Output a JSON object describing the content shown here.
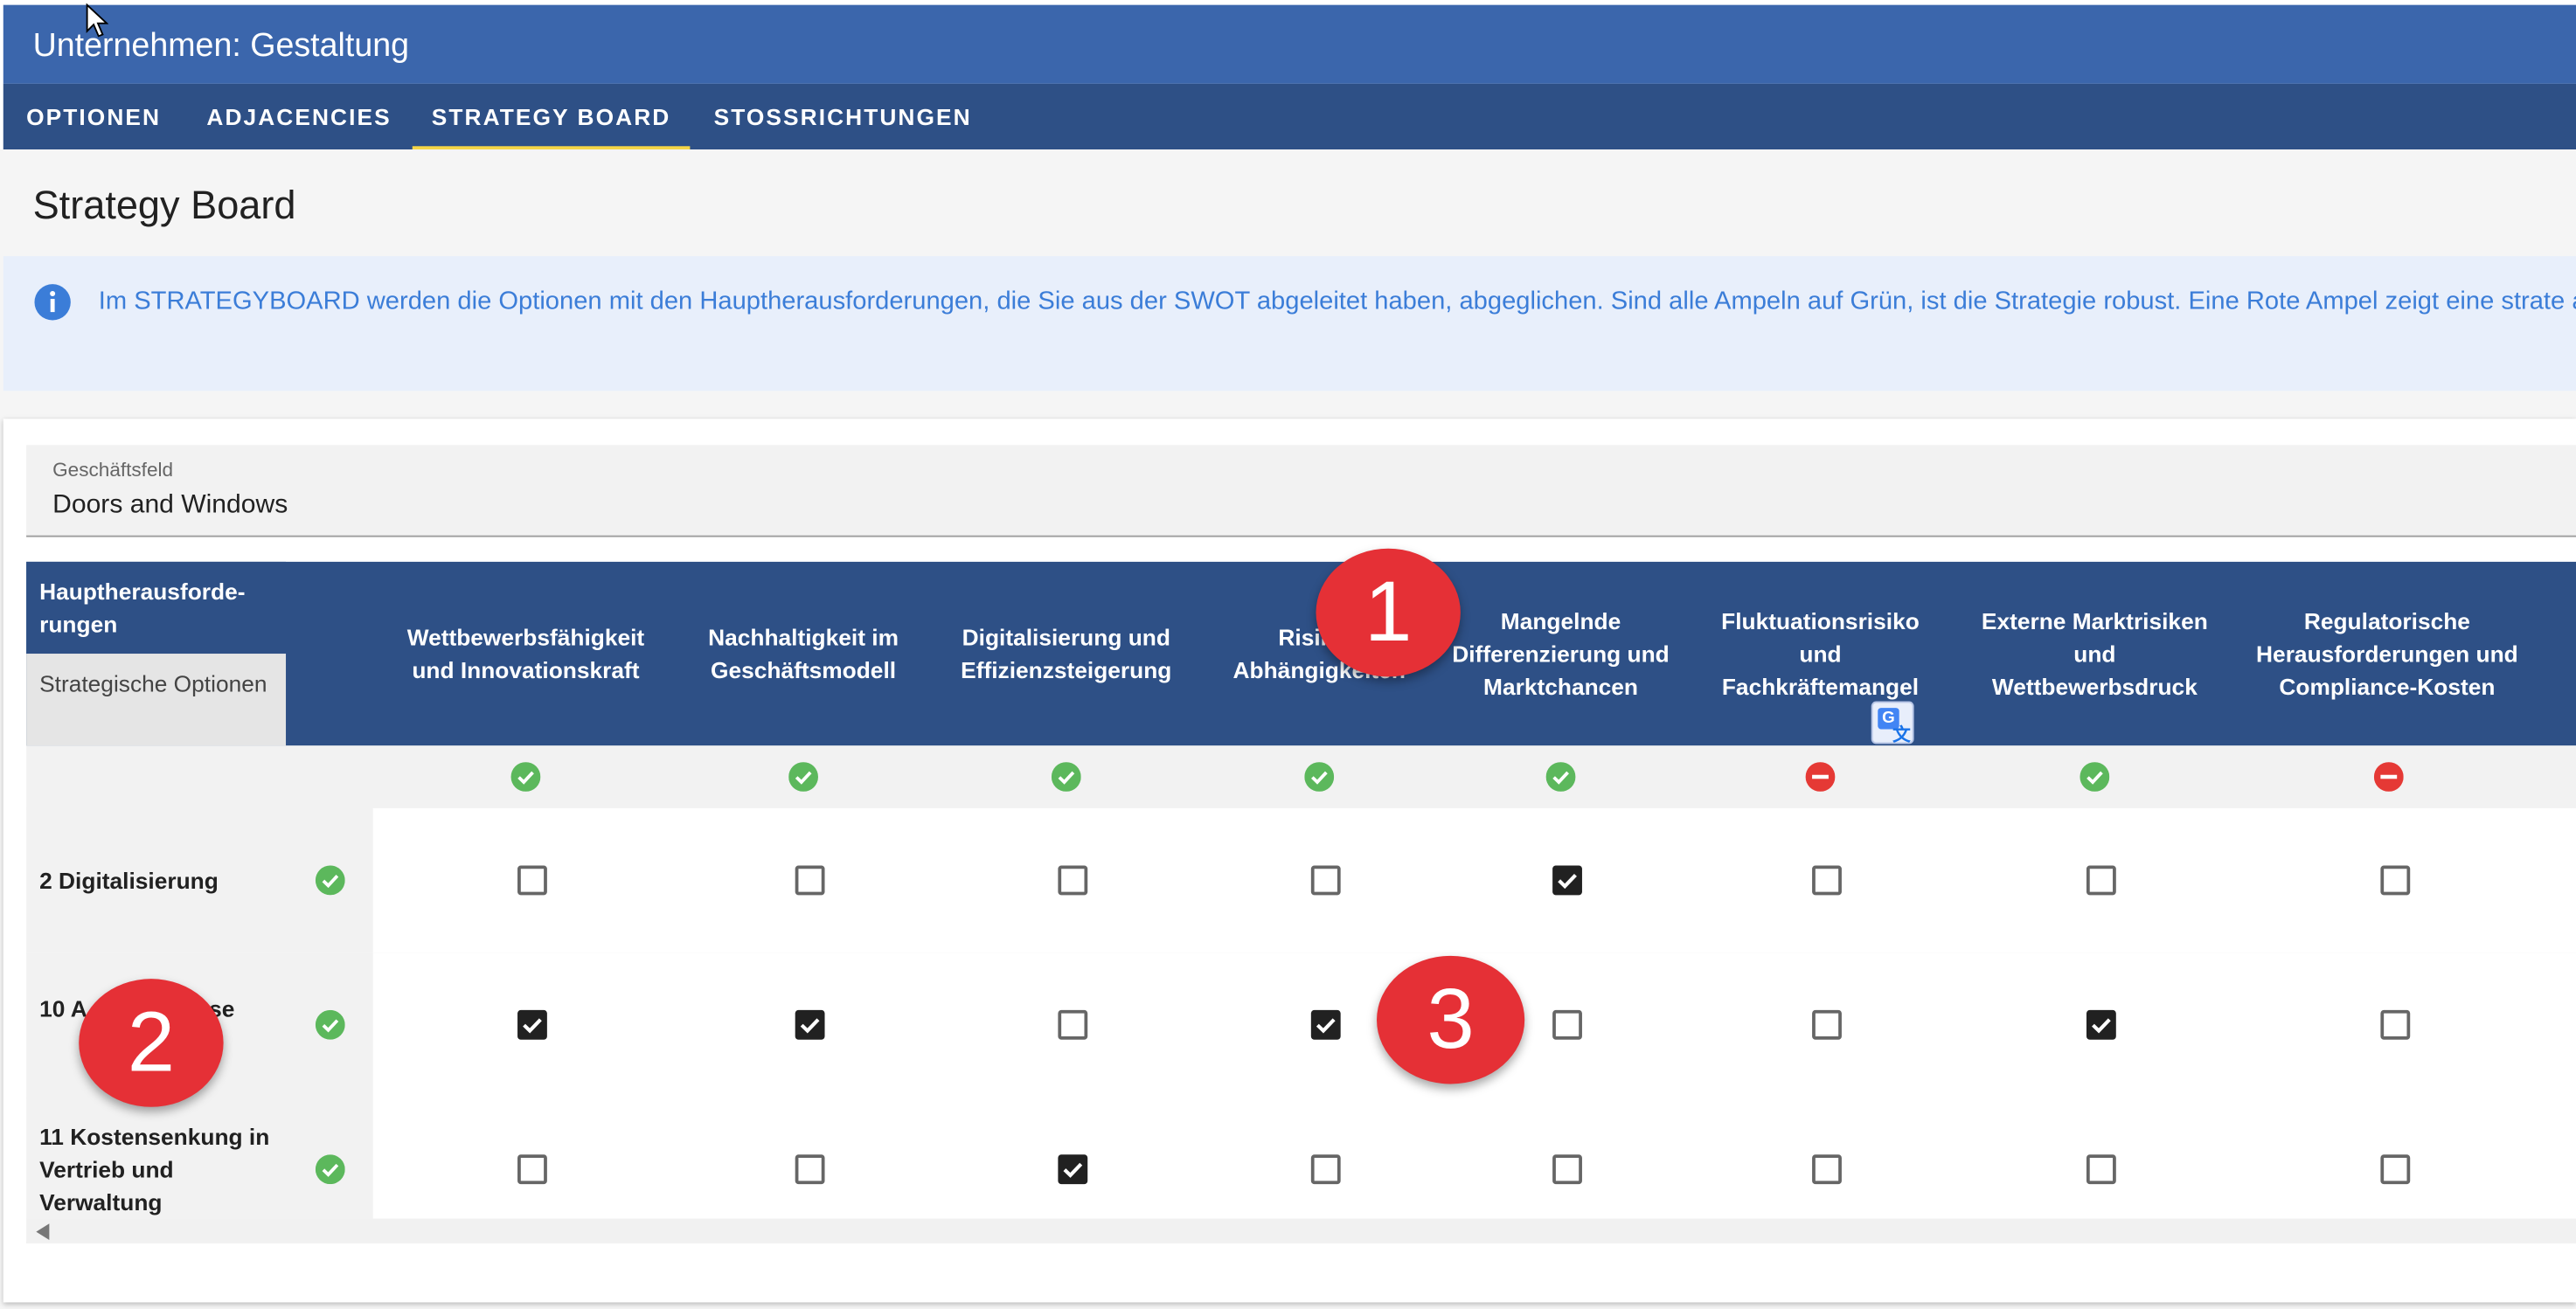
{
  "app": {
    "title": "Unternehmen: Gestaltung"
  },
  "tabs": [
    {
      "label": "OPTIONEN",
      "active": false
    },
    {
      "label": "ADJACENCIES",
      "active": false
    },
    {
      "label": "STRATEGY BOARD",
      "active": true
    },
    {
      "label": "STOSSRICHTUNGEN",
      "active": false
    }
  ],
  "page": {
    "title": "Strategy Board"
  },
  "info": {
    "icon": "info-icon",
    "text": "Im STRATEGYBOARD werden die Optionen mit den Hauptherausforderungen, die Sie aus der SWOT abgeleitet haben, abgeglichen. Sind alle Ampeln auf Grün, ist die Strategie robust. Eine Rote Ampel zeigt eine strate auf."
  },
  "field": {
    "label": "Geschäftsfeld",
    "value": "Doors and Windows"
  },
  "table": {
    "corner_top": "Hauptherausforde-rungen",
    "corner_bottom": "Strategische Optionen",
    "columns": [
      {
        "label": "Wettbewerbsfähigkeit und Innovationskraft",
        "status": "green"
      },
      {
        "label": "Nachhaltigkeit im Geschäftsmodell",
        "status": "green"
      },
      {
        "label": "Digitalisierung und Effizienzsteigerung",
        "status": "green"
      },
      {
        "label": "Risiken Abhängigkeiten",
        "status": "green"
      },
      {
        "label": "Mangelnde Differenzierung und Marktchancen",
        "status": "green"
      },
      {
        "label": "Fluktuationsrisiko und Fachkräftemangel",
        "status": "red"
      },
      {
        "label": "Externe Marktrisiken und Wettbewerbsdruck",
        "status": "green"
      },
      {
        "label": "Regulatorische Herausforderungen und Compliance-Kosten",
        "status": "red"
      }
    ],
    "rows": [
      {
        "label": "2 Digitalisierung",
        "status": "green",
        "checks": [
          false,
          false,
          false,
          false,
          true,
          false,
          false,
          false
        ]
      },
      {
        "label": "10 A ung der esse",
        "status": "green",
        "checks": [
          true,
          true,
          false,
          true,
          false,
          false,
          true,
          false
        ]
      },
      {
        "label": "11 Kostensenkung in Vertrieb und Verwaltung",
        "status": "green",
        "checks": [
          false,
          false,
          true,
          false,
          false,
          false,
          false,
          false
        ]
      }
    ]
  },
  "markers": [
    "1",
    "2",
    "3"
  ],
  "colors": {
    "appbar": "#3b66ac",
    "tabbar": "#2e5086",
    "tab_indicator": "#f5d547",
    "ok": "#5cb85c",
    "error": "#e53935",
    "info": "#3b7dd8"
  }
}
